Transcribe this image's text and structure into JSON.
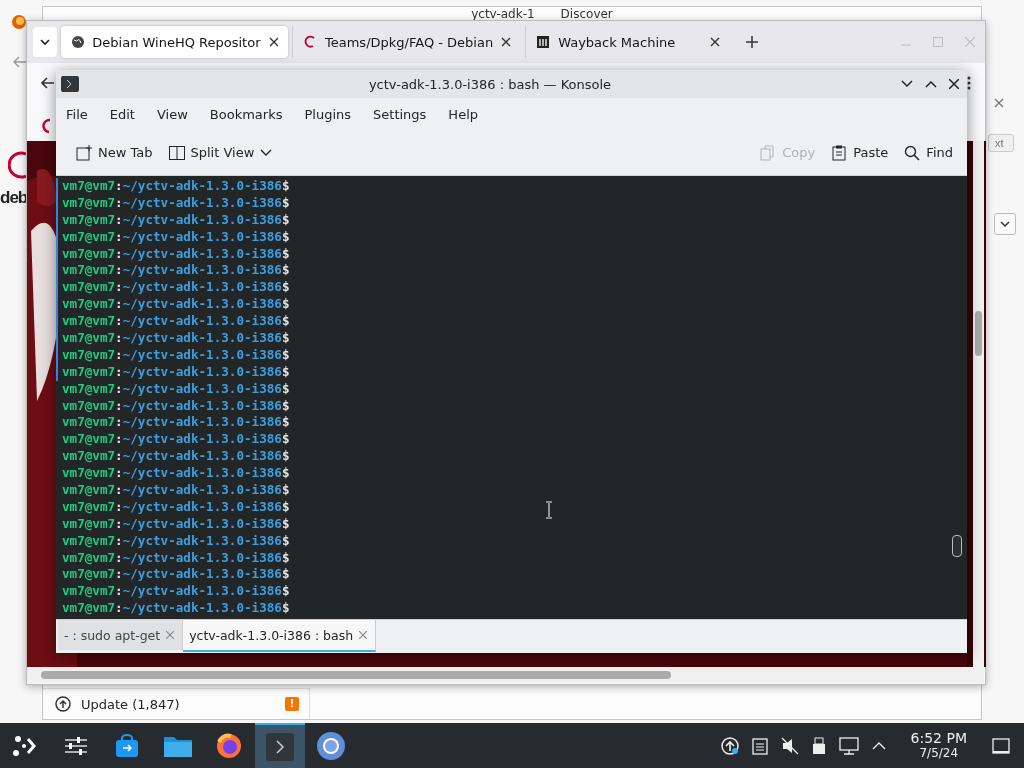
{
  "discover": {
    "title_start": "yctv-adk-1",
    "title_end": "Discover",
    "status": "Update (1,847)",
    "warning": "!"
  },
  "behind": {
    "page_text": "deb",
    "button_text": "xt"
  },
  "browser": {
    "tabs": [
      {
        "title": "Debian WineHQ Repositor",
        "kind": "globe",
        "selected": true
      },
      {
        "title": "Teams/Dpkg/FAQ - Debian",
        "kind": "swirl",
        "selected": false
      },
      {
        "title": "Wayback Machine",
        "kind": "archive",
        "selected": false
      }
    ]
  },
  "konsole": {
    "title": "yctv-adk-1.3.0-i386 : bash — Konsole",
    "menu": [
      "File",
      "Edit",
      "View",
      "Bookmarks",
      "Plugins",
      "Settings",
      "Help"
    ],
    "toolbar_left": [
      {
        "label": "New Tab",
        "kind": "new-tab",
        "disabled": false
      },
      {
        "label": "Split View",
        "kind": "split",
        "disabled": false
      }
    ],
    "toolbar_right": [
      {
        "label": "Copy",
        "kind": "copy",
        "disabled": true
      },
      {
        "label": "Paste",
        "kind": "paste",
        "disabled": false
      },
      {
        "label": "Find",
        "kind": "find",
        "disabled": false
      }
    ],
    "lines": [
      {
        "user": "vm7@vm7",
        "sep": ":",
        "path": "~/yctv-adk-1.3.0-i386",
        "end": "$",
        "marked": true
      },
      {
        "user": "vm7@vm7",
        "sep": ":",
        "path": "~/yctv-adk-1.3.0-i386",
        "end": "$",
        "marked": true
      },
      {
        "user": "vm7@vm7",
        "sep": ":",
        "path": "~/yctv-adk-1.3.0-i386",
        "end": "$",
        "marked": true
      },
      {
        "user": "vm7@vm7",
        "sep": ":",
        "path": "~/yctv-adk-1.3.0-i386",
        "end": "$",
        "marked": true
      },
      {
        "user": "vm7@vm7",
        "sep": ":",
        "path": "~/yctv-adk-1.3.0-i386",
        "end": "$",
        "marked": true
      },
      {
        "user": "vm7@vm7",
        "sep": ":",
        "path": "~/yctv-adk-1.3.0-i386",
        "end": "$",
        "marked": true
      },
      {
        "user": "vm7@vm7",
        "sep": ":",
        "path": "~/yctv-adk-1.3.0-i386",
        "end": "$",
        "marked": true
      },
      {
        "user": "vm7@vm7",
        "sep": ":",
        "path": "~/yctv-adk-1.3.0-i386",
        "end": "$",
        "marked": true
      },
      {
        "user": "vm7@vm7",
        "sep": ":",
        "path": "~/yctv-adk-1.3.0-i386",
        "end": "$",
        "marked": true
      },
      {
        "user": "vm7@vm7",
        "sep": ":",
        "path": "~/yctv-adk-1.3.0-i386",
        "end": "$",
        "marked": true
      },
      {
        "user": "vm7@vm7",
        "sep": ":",
        "path": "~/yctv-adk-1.3.0-i386",
        "end": "$",
        "marked": true
      },
      {
        "user": "vm7@vm7",
        "sep": ":",
        "path": "~/yctv-adk-1.3.0-i386",
        "end": "$",
        "marked": true
      },
      {
        "user": "vm7@vm7",
        "sep": ":",
        "path": "~/yctv-adk-1.3.0-i386",
        "end": "$",
        "marked": false
      },
      {
        "user": "vm7@vm7",
        "sep": ":",
        "path": "~/yctv-adk-1.3.0-i386",
        "end": "$",
        "marked": false
      },
      {
        "user": "vm7@vm7",
        "sep": ":",
        "path": "~/yctv-adk-1.3.0-i386",
        "end": "$",
        "marked": false
      },
      {
        "user": "vm7@vm7",
        "sep": ":",
        "path": "~/yctv-adk-1.3.0-i386",
        "end": "$",
        "marked": false
      },
      {
        "user": "vm7@vm7",
        "sep": ":",
        "path": "~/yctv-adk-1.3.0-i386",
        "end": "$",
        "marked": false
      },
      {
        "user": "vm7@vm7",
        "sep": ":",
        "path": "~/yctv-adk-1.3.0-i386",
        "end": "$",
        "marked": false
      },
      {
        "user": "vm7@vm7",
        "sep": ":",
        "path": "~/yctv-adk-1.3.0-i386",
        "end": "$",
        "marked": false
      },
      {
        "user": "vm7@vm7",
        "sep": ":",
        "path": "~/yctv-adk-1.3.0-i386",
        "end": "$",
        "marked": false
      },
      {
        "user": "vm7@vm7",
        "sep": ":",
        "path": "~/yctv-adk-1.3.0-i386",
        "end": "$",
        "marked": false
      },
      {
        "user": "vm7@vm7",
        "sep": ":",
        "path": "~/yctv-adk-1.3.0-i386",
        "end": "$",
        "marked": false
      },
      {
        "user": "vm7@vm7",
        "sep": ":",
        "path": "~/yctv-adk-1.3.0-i386",
        "end": "$",
        "marked": false
      },
      {
        "user": "vm7@vm7",
        "sep": ":",
        "path": "~/yctv-adk-1.3.0-i386",
        "end": "$",
        "marked": false
      },
      {
        "user": "vm7@vm7",
        "sep": ":",
        "path": "~/yctv-adk-1.3.0-i386",
        "end": "$",
        "marked": false
      },
      {
        "user": "vm7@vm7",
        "sep": ":",
        "path": "~/yctv-adk-1.3.0-i386",
        "end": "$",
        "marked": false
      }
    ],
    "tabs": [
      {
        "title": "- : sudo apt-get",
        "selected": false
      },
      {
        "title": "yctv-adk-1.3.0-i386 : bash",
        "selected": true
      }
    ]
  },
  "taskbar": {
    "apps": [
      {
        "kind": "launcher",
        "selected": false
      },
      {
        "kind": "settings",
        "selected": false
      },
      {
        "kind": "store",
        "selected": false
      },
      {
        "kind": "folder",
        "selected": false
      },
      {
        "kind": "browser-fox",
        "selected": false
      },
      {
        "kind": "terminal",
        "selected": true
      },
      {
        "kind": "browser-round",
        "selected": false
      }
    ],
    "time": "6:52 PM",
    "date": "7/5/24"
  }
}
